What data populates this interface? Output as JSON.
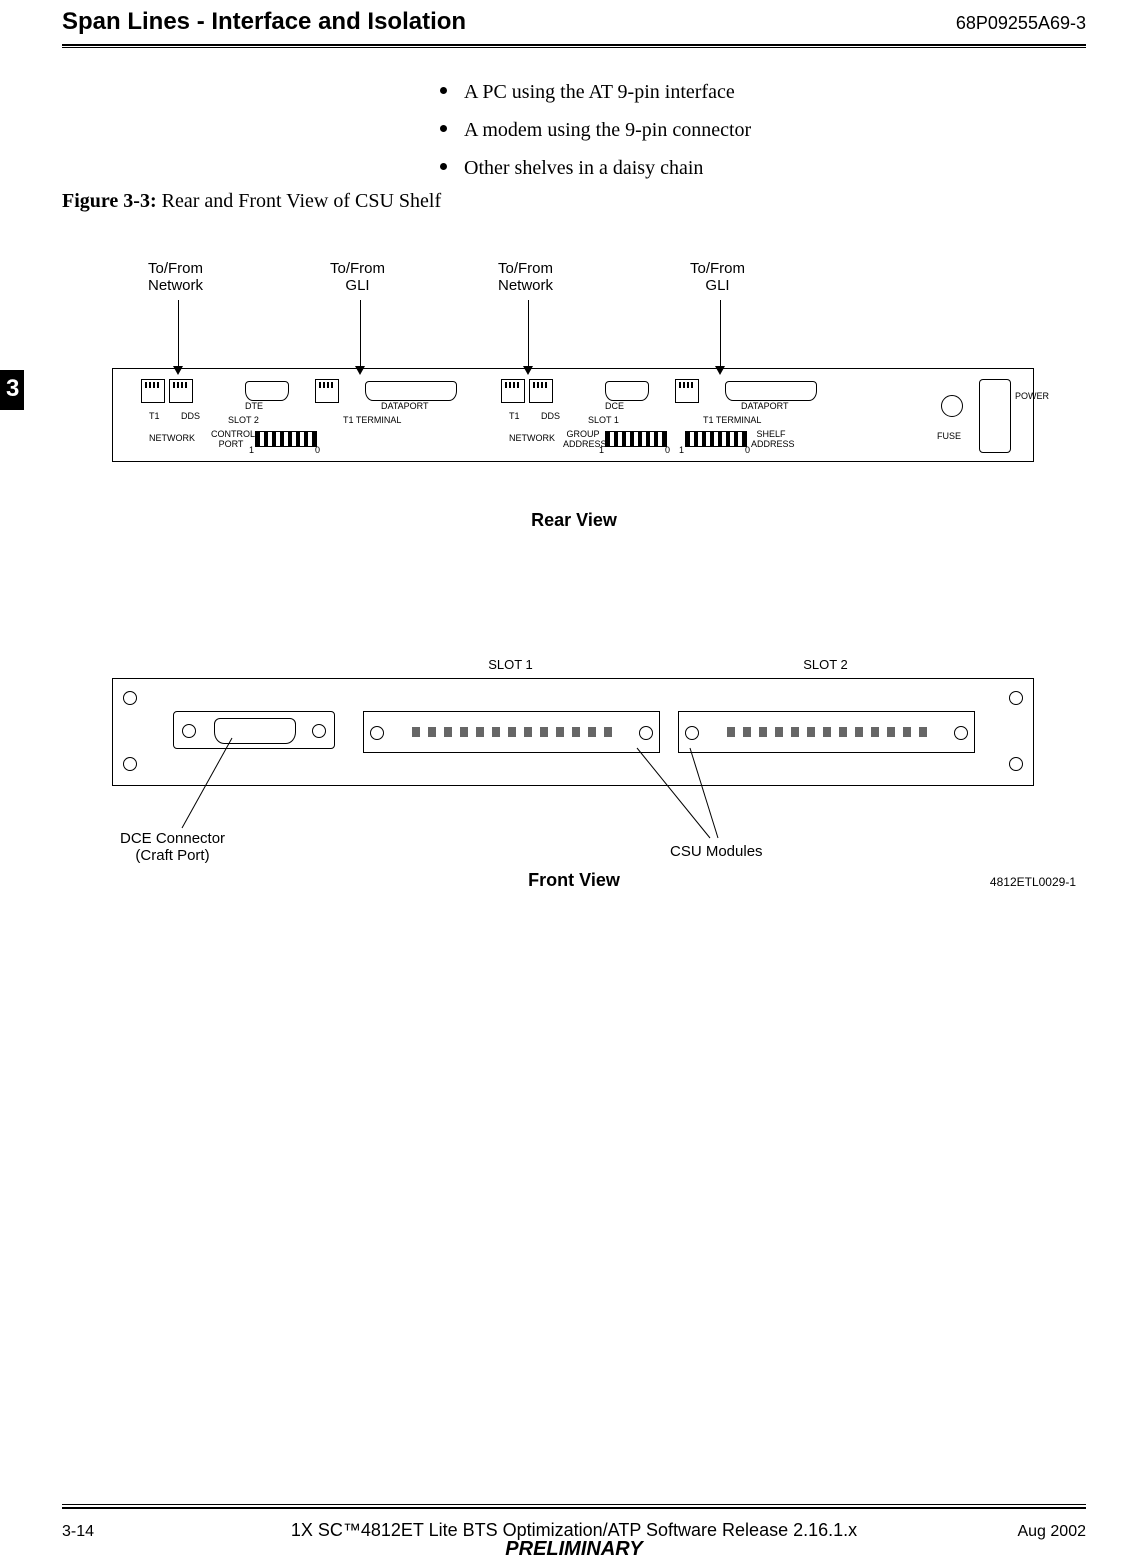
{
  "header": {
    "title": "Span Lines - Interface and Isolation",
    "docnum": "68P09255A69-3"
  },
  "bullets": [
    "A PC using the AT 9-pin interface",
    "A modem using the 9-pin connector",
    "Other shelves in a daisy chain"
  ],
  "figure": {
    "caption_bold": "Figure 3-3:",
    "caption_rest": " Rear and Front View of CSU Shelf",
    "id": "4812ETL0029-1"
  },
  "callouts": {
    "net1": "To/From\nNetwork",
    "gli1": "To/From\nGLI",
    "net2": "To/From\nNetwork",
    "gli2": "To/From\nGLI"
  },
  "rear": {
    "label": "Rear View",
    "slot2_labels": {
      "dte": "DTE",
      "dataport": "DATAPORT",
      "t1": "T1",
      "dds": "DDS",
      "network": "NETWORK",
      "slot": "SLOT 2",
      "term": "T1 TERMINAL",
      "ctrlport": "CONTROL\nPORT",
      "one": "1",
      "zero": "0"
    },
    "slot1_labels": {
      "dce": "DCE",
      "dataport": "DATAPORT",
      "t1": "T1",
      "dds": "DDS",
      "network": "NETWORK",
      "slot": "SLOT 1",
      "term": "T1 TERMINAL",
      "group": "GROUP\nADDRESS",
      "shelf": "SHELF\nADDRESS",
      "one": "1",
      "zero": "0"
    },
    "right": {
      "fuse": "FUSE",
      "power": "POWER"
    }
  },
  "front": {
    "label": "Front View",
    "slot1": "SLOT 1",
    "slot2": "SLOT 2",
    "dce_label": "DCE Connector\n(Craft Port)",
    "csu_label": "CSU Modules"
  },
  "tab": "3",
  "footer": {
    "page": "3-14",
    "mid": "1X SC™4812ET Lite BTS Optimization/ATP Software Release 2.16.1.x",
    "date": "Aug 2002",
    "preliminary": "PRELIMINARY"
  }
}
